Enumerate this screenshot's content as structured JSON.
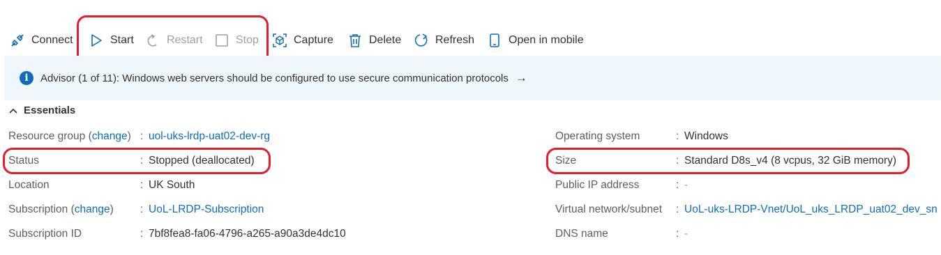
{
  "toolbar": {
    "connect": "Connect",
    "start": "Start",
    "restart": "Restart",
    "stop": "Stop",
    "capture": "Capture",
    "delete": "Delete",
    "refresh": "Refresh",
    "open_mobile": "Open in mobile"
  },
  "banner": {
    "message": "Advisor (1 of 11): Windows web servers should be configured to use secure communication protocols",
    "arrow": "→"
  },
  "essentials": {
    "title": "Essentials"
  },
  "left": {
    "resource_group_label": "Resource group (",
    "change1": "change",
    "paren_close1": ")",
    "resource_group_value": "uol-uks-lrdp-uat02-dev-rg",
    "status_label": "Status",
    "status_value": "Stopped (deallocated)",
    "location_label": "Location",
    "location_value": "UK South",
    "subscription_label": "Subscription (",
    "change2": "change",
    "paren_close2": ")",
    "subscription_value": "UoL-LRDP-Subscription",
    "subscription_id_label": "Subscription ID",
    "subscription_id_value": "7bf8fea8-fa06-4796-a265-a90a3de4dc10"
  },
  "right": {
    "os_label": "Operating system",
    "os_value": "Windows",
    "size_label": "Size",
    "size_value": "Standard D8s_v4 (8 vcpus, 32 GiB memory)",
    "public_ip_label": "Public IP address",
    "public_ip_value": "-",
    "vnet_label": "Virtual network/subnet",
    "vnet_value": "UoL-uks-LRDP-Vnet/UoL_uks_LRDP_uat02_dev_sn",
    "dns_label": "DNS name",
    "dns_value": "-"
  },
  "colon": ":",
  "colors": {
    "accent": "#0f6cbd",
    "highlight": "#e0202f",
    "banner_bg": "#eff6fc"
  }
}
